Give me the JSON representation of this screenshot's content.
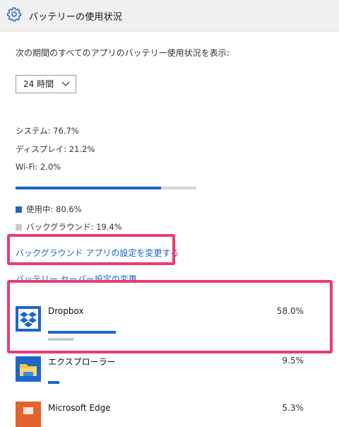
{
  "header": {
    "title": "バッテリーの使用状況",
    "icon": "gear-icon"
  },
  "description": "次の期間のすべてのアプリのバッテリー使用状況を表示:",
  "period_select": {
    "selected": "24 時間"
  },
  "usage_stats": [
    "システム: 76.7%",
    "ディスプレイ: 21.2%",
    "Wi-Fi: 2.0%"
  ],
  "overall_usage_fraction": 0.806,
  "legend": {
    "in_use": "使用中: 80.6%",
    "background": "バックグラウンド: 19.4%"
  },
  "links": {
    "background_apps": "バックグラウンド アプリの設定を変更する",
    "battery_saver": "バッテリー セーバー設定の変更"
  },
  "apps": [
    {
      "name": "Dropbox",
      "percent": "58.0%",
      "icon": "dropbox-icon",
      "usage_fraction": 0.58
    },
    {
      "name": "エクスプローラー",
      "percent": "9.5%",
      "icon": "folder-icon",
      "usage_fraction": 0.095
    },
    {
      "name": "Microsoft Edge",
      "percent": "5.3%",
      "icon": "edge-icon",
      "usage_fraction": 0.053
    }
  ],
  "colors": {
    "accent": "#1e66c8",
    "link": "#1a63c2",
    "highlight": "#ee3a73",
    "bar_background": "#c8c8c8"
  }
}
